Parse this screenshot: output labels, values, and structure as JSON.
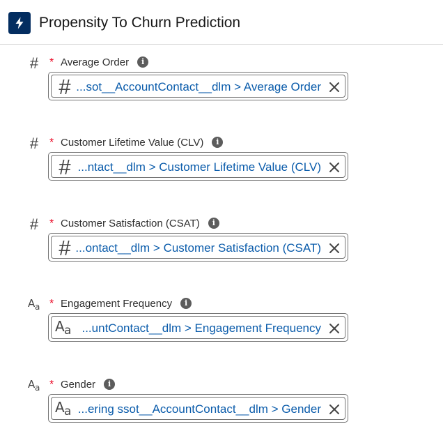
{
  "header": {
    "title": "Propensity To Churn Prediction",
    "icon": "lightning-bolt-icon",
    "icon_bg": "#032d60"
  },
  "required_marker": "*",
  "fields": [
    {
      "type": "number",
      "type_icon": "#",
      "label": "Average Order",
      "value": "...sot__AccountContact__dlm > Average Order"
    },
    {
      "type": "number",
      "type_icon": "#",
      "label": "Customer Lifetime Value (CLV)",
      "value": "...ntact__dlm > Customer Lifetime Value (CLV)"
    },
    {
      "type": "number",
      "type_icon": "#",
      "label": "Customer Satisfaction (CSAT)",
      "value": "...ontact__dlm > Customer Satisfaction (CSAT)"
    },
    {
      "type": "text",
      "type_icon": "Aa",
      "label": "Engagement Frequency",
      "value": "...untContact__dlm > Engagement Frequency"
    },
    {
      "type": "text",
      "type_icon": "Aa",
      "label": "Gender",
      "value": "...ering ssot__AccountContact__dlm > Gender"
    }
  ],
  "colors": {
    "link": "#0b5cab",
    "required": "#ea001e",
    "border": "#747474"
  }
}
